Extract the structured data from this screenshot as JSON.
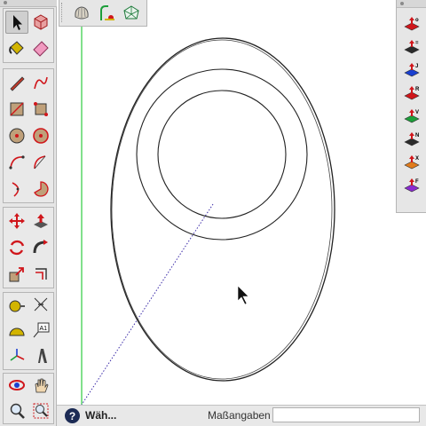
{
  "status_bar": {
    "help_glyph": "?",
    "status_text": "Wäh...",
    "measure_label": "Maßangaben",
    "measure_value": ""
  },
  "right_toolbar": {
    "items": [
      {
        "icon": "component-options-icon",
        "label": "o"
      },
      {
        "icon": "top-view-icon",
        "label": "="
      },
      {
        "icon": "view-j-icon",
        "label": "J"
      },
      {
        "icon": "view-r-icon",
        "label": "R"
      },
      {
        "icon": "view-v-icon",
        "label": "V"
      },
      {
        "icon": "view-n-icon",
        "label": "N"
      },
      {
        "icon": "view-x-icon",
        "label": "X"
      },
      {
        "icon": "view-f-icon",
        "label": "F"
      }
    ]
  },
  "colors": {
    "axis_green": "#2ecc40",
    "axis_blue_dotted": "#3b2ba8",
    "selection_red": "#d0161b",
    "help_navy": "#1c2b55"
  }
}
